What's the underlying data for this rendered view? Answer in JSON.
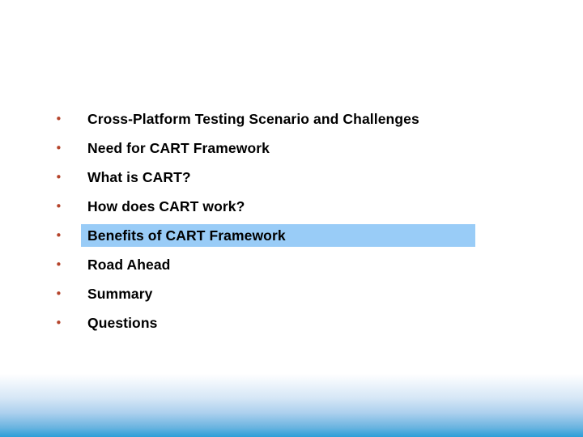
{
  "slide": {
    "type": "agenda-slide",
    "bullet_glyph": "•",
    "bullet_color": "#b5442b",
    "text_color": "#000000",
    "background_color": "#ffffff",
    "highlight_color": "#99ccf7",
    "footer_gradient_top_color": "#ffffff",
    "footer_gradient_bottom_color": "#2d9ed8",
    "items": [
      {
        "label": "Cross-Platform Testing Scenario and Challenges",
        "highlighted": false
      },
      {
        "label": "Need for CART Framework",
        "highlighted": false
      },
      {
        "label": "What is CART?",
        "highlighted": false
      },
      {
        "label": "How does CART work?",
        "highlighted": false
      },
      {
        "label": "Benefits of CART Framework",
        "highlighted": true
      },
      {
        "label": "Road Ahead",
        "highlighted": false
      },
      {
        "label": "Summary",
        "highlighted": false
      },
      {
        "label": "Questions",
        "highlighted": false
      }
    ]
  }
}
